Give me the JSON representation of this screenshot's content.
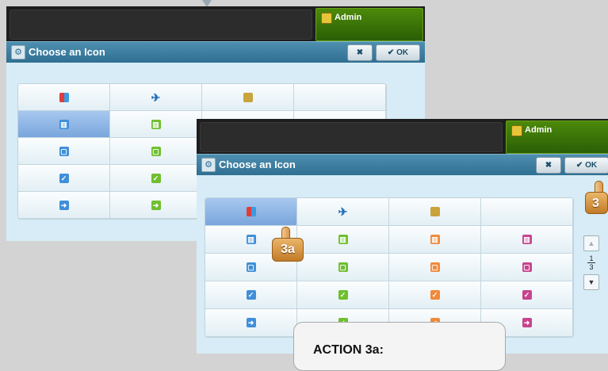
{
  "admin_label": "Admin",
  "dialog_title": "Choose an Icon",
  "ok_label": "OK",
  "cancel_glyph": "✖",
  "pager": {
    "current": "1",
    "total": "3"
  },
  "steps": {
    "step_3a": "3a",
    "step_3": "3"
  },
  "callout_title": "ACTION 3a:",
  "icons": {
    "colors": "palette-icon",
    "plane": "airplane-icon",
    "box": "box-icon",
    "bank": "bank-icon",
    "clipboard": "clipboard-icon",
    "check": "check-icon",
    "arrow": "arrow-icon"
  },
  "accent_colors": {
    "blue": "#3f8fd9",
    "green": "#6fbf2f",
    "orange": "#f08a3c",
    "pink": "#c8438d",
    "gold": "#c9a33b"
  }
}
